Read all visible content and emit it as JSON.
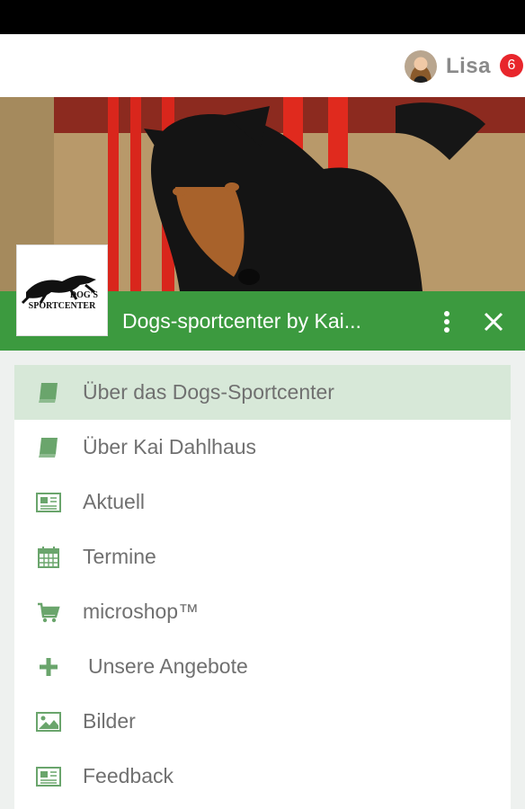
{
  "topbar": {
    "user_name": "Lisa",
    "notification_count": "6"
  },
  "header": {
    "title": "Dogs-sportcenter by Kai...",
    "logo_text_line1": "DOG'S",
    "logo_text_line2": "SPORTCENTER"
  },
  "menu": {
    "items": [
      {
        "label": "Über das Dogs-Sportcenter",
        "icon": "book-icon",
        "active": true
      },
      {
        "label": "Über Kai Dahlhaus",
        "icon": "book-icon"
      },
      {
        "label": "Aktuell",
        "icon": "newspaper-icon"
      },
      {
        "label": "Termine",
        "icon": "calendar-icon"
      },
      {
        "label": "microshop™",
        "icon": "cart-icon"
      },
      {
        "label": "Unsere Angebote",
        "icon": "plus-icon"
      },
      {
        "label": "Bilder",
        "icon": "image-icon"
      },
      {
        "label": "Feedback",
        "icon": "newspaper-icon"
      }
    ]
  },
  "colors": {
    "accent_green": "#3c9a3f",
    "active_bg": "#d7e8d8",
    "icon_green": "#6aa56c",
    "badge_red": "#e8262c"
  }
}
